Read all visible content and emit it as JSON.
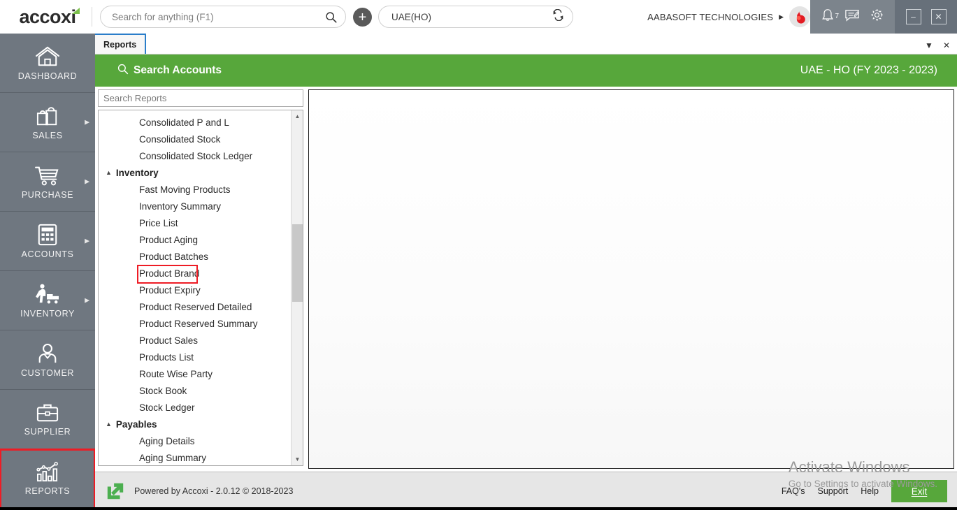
{
  "app": {
    "logo_text": "accoxi",
    "company": "AABASOFT TECHNOLOGIES",
    "company_caret": "▶"
  },
  "topbar": {
    "search_placeholder": "Search for anything (F1)",
    "search_value": "",
    "search_icon": "search-icon",
    "add_label": "+",
    "branch_value": "UAE(HO)",
    "branch_switch_icon": "switch-branch-icon",
    "notification_count": "7",
    "icons": [
      "bell-icon",
      "message-icon",
      "gear-icon"
    ],
    "window_minimize": "–",
    "window_close": "✕"
  },
  "sidebar": {
    "items": [
      {
        "label": "DASHBOARD",
        "icon": "home-icon",
        "has_arrow": false,
        "highlighted": false
      },
      {
        "label": "SALES",
        "icon": "shopping-bag-icon",
        "has_arrow": true,
        "highlighted": false
      },
      {
        "label": "PURCHASE",
        "icon": "shopping-cart-icon",
        "has_arrow": true,
        "highlighted": false
      },
      {
        "label": "ACCOUNTS",
        "icon": "calculator-icon",
        "has_arrow": true,
        "highlighted": false
      },
      {
        "label": "INVENTORY",
        "icon": "warehouse-worker-icon",
        "has_arrow": true,
        "highlighted": false
      },
      {
        "label": "CUSTOMER",
        "icon": "person-icon",
        "has_arrow": false,
        "highlighted": false
      },
      {
        "label": "SUPPLIER",
        "icon": "briefcase-icon",
        "has_arrow": false,
        "highlighted": false
      },
      {
        "label": "REPORTS",
        "icon": "bar-chart-icon",
        "has_arrow": false,
        "highlighted": true
      }
    ],
    "arrow_glyph": "▶"
  },
  "tabstrip": {
    "tabs": [
      {
        "label": "Reports",
        "active": true
      }
    ],
    "dropdown_glyph": "▼",
    "close_glyph": "✕"
  },
  "green_header": {
    "search_icon": "search-icon",
    "title": "Search Accounts",
    "context": "UAE - HO (FY 2023 - 2023)",
    "color": "#57a73b"
  },
  "reports_panel": {
    "search_placeholder": "Search Reports",
    "search_value": "",
    "collapse_glyph": "▲",
    "scroll_up_glyph": "▲",
    "scroll_down_glyph": "▼",
    "entries": [
      {
        "type": "item",
        "label": "Consolidated P and L",
        "marked": false
      },
      {
        "type": "item",
        "label": "Consolidated Stock",
        "marked": false
      },
      {
        "type": "item",
        "label": "Consolidated Stock Ledger",
        "marked": false
      },
      {
        "type": "group",
        "label": "Inventory"
      },
      {
        "type": "item",
        "label": "Fast Moving Products",
        "marked": false
      },
      {
        "type": "item",
        "label": "Inventory Summary",
        "marked": false
      },
      {
        "type": "item",
        "label": "Price List",
        "marked": false
      },
      {
        "type": "item",
        "label": "Product Aging",
        "marked": false
      },
      {
        "type": "item",
        "label": "Product Batches",
        "marked": false
      },
      {
        "type": "item",
        "label": "Product Brand",
        "marked": true
      },
      {
        "type": "item",
        "label": "Product Expiry",
        "marked": false
      },
      {
        "type": "item",
        "label": "Product Reserved Detailed",
        "marked": false
      },
      {
        "type": "item",
        "label": "Product Reserved Summary",
        "marked": false
      },
      {
        "type": "item",
        "label": "Product Sales",
        "marked": false
      },
      {
        "type": "item",
        "label": "Products List",
        "marked": false
      },
      {
        "type": "item",
        "label": "Route Wise Party",
        "marked": false
      },
      {
        "type": "item",
        "label": "Stock Book",
        "marked": false
      },
      {
        "type": "item",
        "label": "Stock Ledger",
        "marked": false
      },
      {
        "type": "group",
        "label": "Payables"
      },
      {
        "type": "item",
        "label": "Aging Details",
        "marked": false
      },
      {
        "type": "item",
        "label": "Aging Summary",
        "marked": false
      }
    ]
  },
  "footer": {
    "powered_by": "Powered by Accoxi - 2.0.12 © 2018-2023",
    "links": [
      "FAQ's",
      "Support",
      "Help"
    ],
    "exit_label": "Exit"
  },
  "watermark": {
    "title": "Activate Windows",
    "subtitle": "Go to Settings to activate Windows."
  },
  "colors": {
    "accent_green": "#57a73b",
    "sidebar_gray": "#6f7780",
    "highlight_red": "#ee1c25",
    "tab_blue": "#2a7dc9"
  }
}
